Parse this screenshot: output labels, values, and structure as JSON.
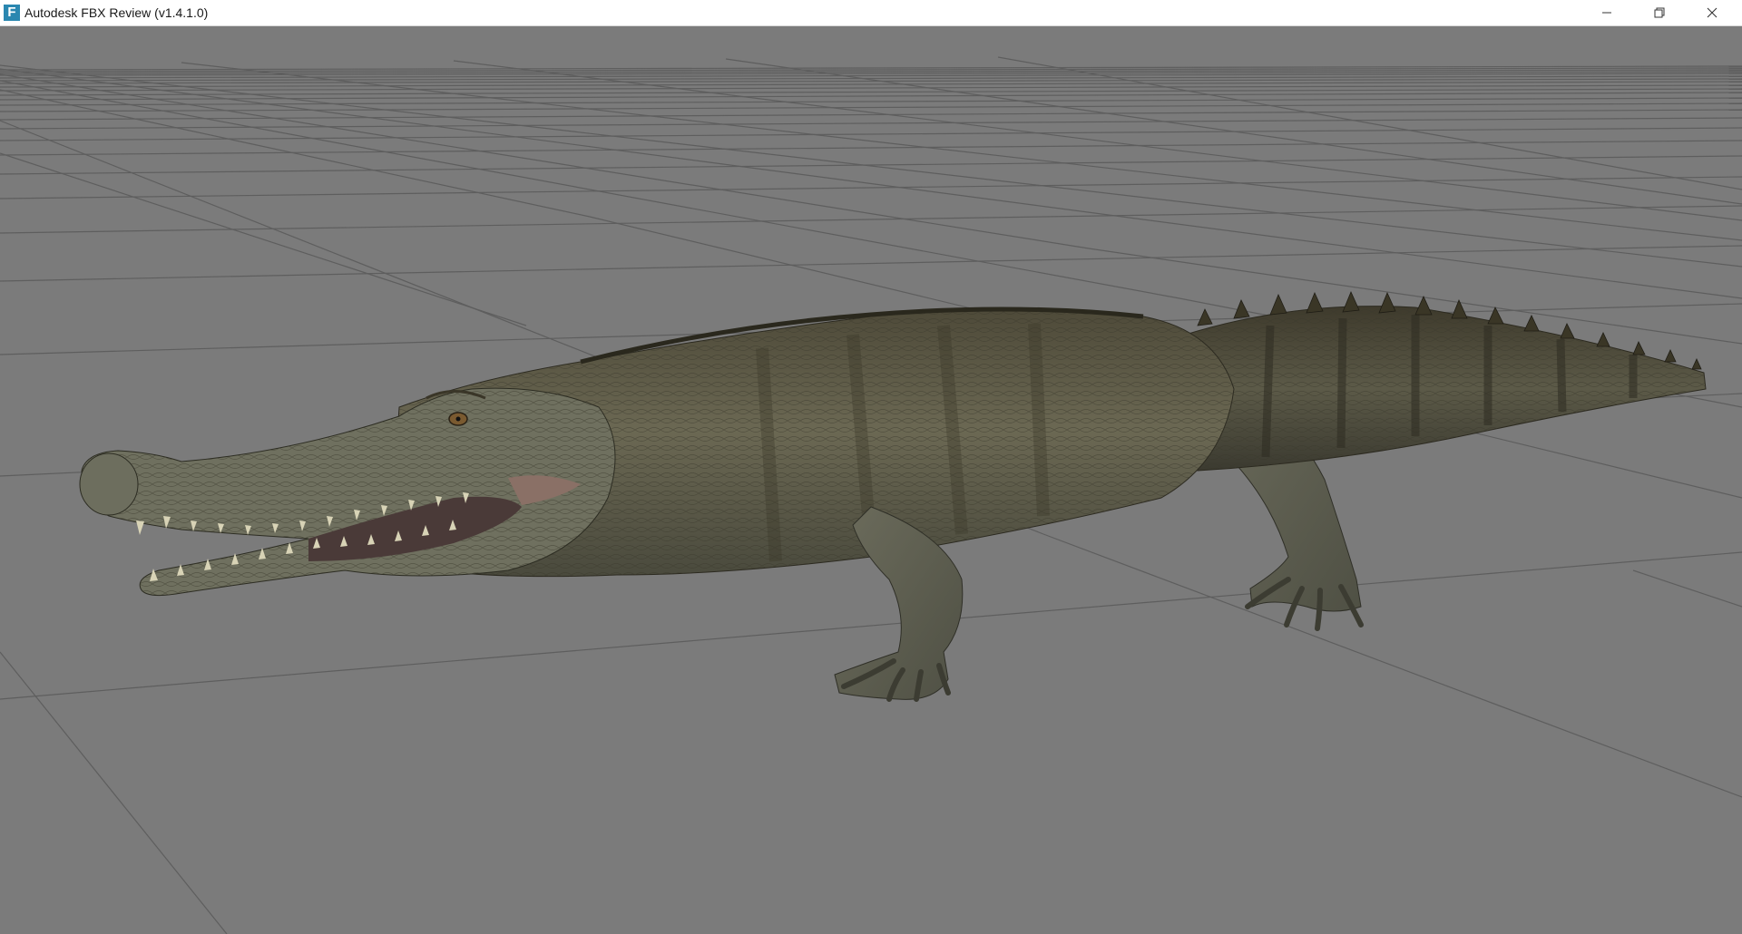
{
  "window": {
    "title": "Autodesk FBX Review (v1.4.1.0)",
    "app_icon_letter": "F",
    "icons": {
      "app": "fbx-review-app-icon",
      "minimize": "minimize-icon",
      "restore": "restore-icon",
      "close": "close-icon"
    }
  },
  "viewport": {
    "background": "#7b7b7b",
    "grid_color": "#5c5c5c",
    "model": "crocodile-model"
  }
}
